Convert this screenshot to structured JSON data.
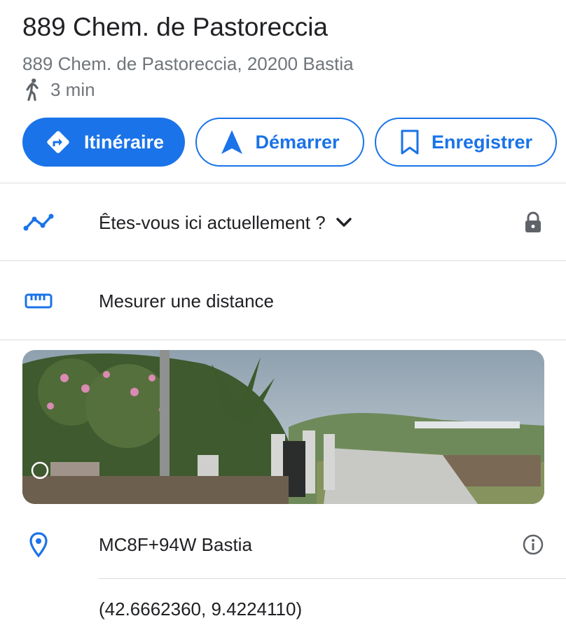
{
  "place": {
    "title": "889 Chem. de Pastoreccia",
    "address": "889 Chem. de Pastoreccia, 20200 Bastia",
    "walk_time": "3 min",
    "walk_icon": "pedestrian-icon"
  },
  "actions": {
    "directions_label": "Itinéraire",
    "start_label": "Démarrer",
    "save_label": "Enregistrer"
  },
  "rows": {
    "here_label": "Êtes-vous ici actuellement ?",
    "measure_label": "Mesurer une distance",
    "plus_code": "MC8F+94W Bastia",
    "coordinates": "(42.6662360, 9.4224110)"
  },
  "colors": {
    "accent": "#1a73e8",
    "text": "#202124",
    "secondary_text": "#70757a",
    "divider": "#dadce0"
  }
}
